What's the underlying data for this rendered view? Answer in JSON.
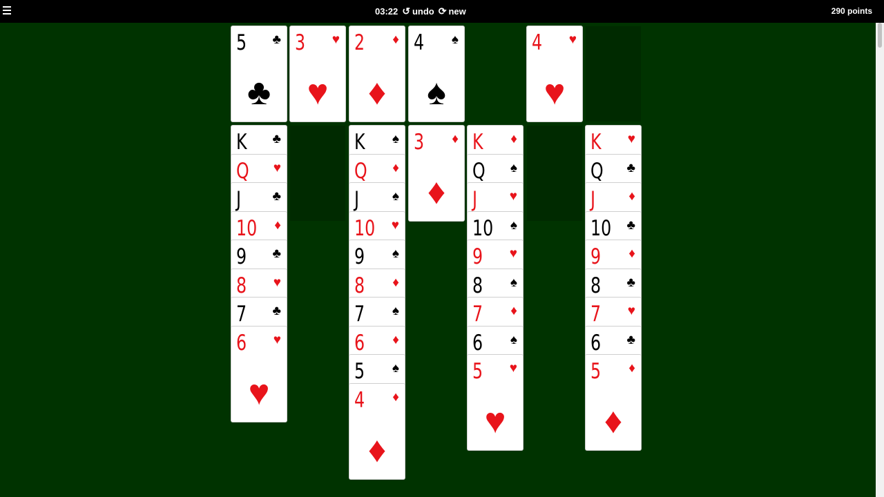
{
  "header": {
    "timer": "03:22",
    "undo_label": "undo",
    "new_label": "new",
    "score": "290 points"
  },
  "foundations": [
    {
      "rank": "5",
      "suit": "♣",
      "color": "black"
    },
    {
      "rank": "3",
      "suit": "♥",
      "color": "red"
    },
    {
      "rank": "2",
      "suit": "♦",
      "color": "red"
    },
    {
      "rank": "4",
      "suit": "♠",
      "color": "black"
    },
    null,
    {
      "rank": "4",
      "suit": "♥",
      "color": "red"
    },
    null
  ],
  "tableau": [
    [
      [
        "K",
        "♣"
      ],
      [
        "Q",
        "♥"
      ],
      [
        "J",
        "♣"
      ],
      [
        "10",
        "♦"
      ],
      [
        "9",
        "♣"
      ],
      [
        "8",
        "♥"
      ],
      [
        "7",
        "♣"
      ],
      [
        "6",
        "♥"
      ]
    ],
    [],
    [
      [
        "K",
        "♠"
      ],
      [
        "Q",
        "♦"
      ],
      [
        "J",
        "♠"
      ],
      [
        "10",
        "♥"
      ],
      [
        "9",
        "♠"
      ],
      [
        "8",
        "♦"
      ],
      [
        "7",
        "♠"
      ],
      [
        "6",
        "♦"
      ],
      [
        "5",
        "♠"
      ],
      [
        "4",
        "♦"
      ]
    ],
    [
      [
        "3",
        "♦"
      ]
    ],
    [
      [
        "K",
        "♦"
      ],
      [
        "Q",
        "♠"
      ],
      [
        "J",
        "♥"
      ],
      [
        "10",
        "♠"
      ],
      [
        "9",
        "♥"
      ],
      [
        "8",
        "♠"
      ],
      [
        "7",
        "♦"
      ],
      [
        "6",
        "♠"
      ],
      [
        "5",
        "♥"
      ]
    ],
    [],
    [
      [
        "K",
        "♥"
      ],
      [
        "Q",
        "♣"
      ],
      [
        "J",
        "♦"
      ],
      [
        "10",
        "♣"
      ],
      [
        "9",
        "♦"
      ],
      [
        "8",
        "♣"
      ],
      [
        "7",
        "♥"
      ],
      [
        "6",
        "♣"
      ],
      [
        "5",
        "♦"
      ]
    ]
  ],
  "colors": {
    "felt": "#003300",
    "red": "#e8141b",
    "black": "#000000",
    "slot": "#002a00"
  }
}
